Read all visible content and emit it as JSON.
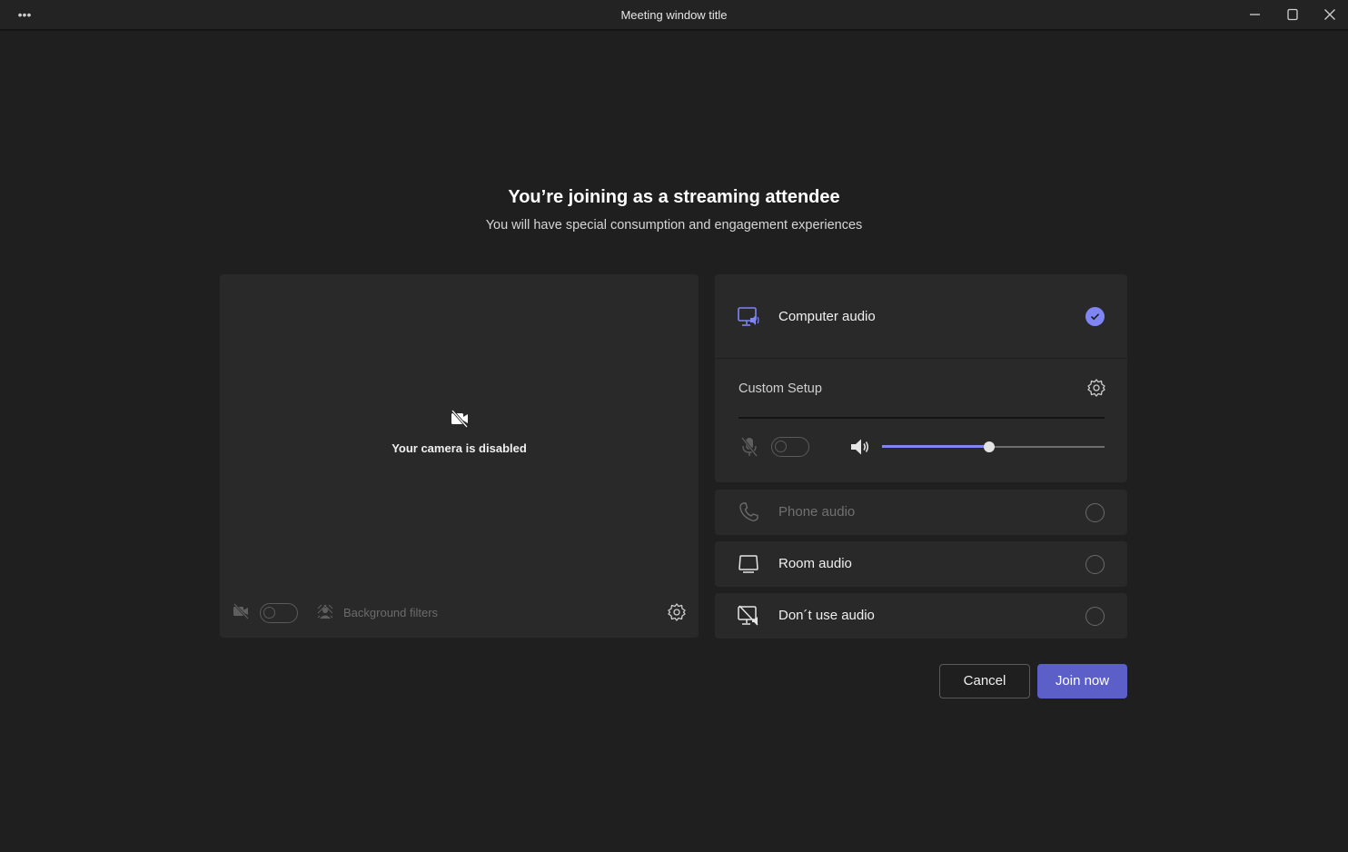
{
  "window": {
    "title": "Meeting window title",
    "more_label": "•••",
    "controls": [
      "minimize",
      "maximize",
      "close"
    ]
  },
  "header": {
    "title": "You’re joining as a streaming attendee",
    "subtitle": "You will have special consumption and engagement experiences"
  },
  "video": {
    "status_text": "Your camera is disabled",
    "camera_toggle_on": false,
    "background_filters_label": "Background filters"
  },
  "audio": {
    "accent_color": "#7f85f5",
    "options": [
      {
        "label": "Computer audio",
        "icon": "computer-audio-icon",
        "selected": true
      },
      {
        "label": "Phone audio",
        "icon": "phone-icon",
        "selected": false,
        "disabled": true
      },
      {
        "label": "Room audio",
        "icon": "room-audio-icon",
        "selected": false
      },
      {
        "label": "Don´t use audio",
        "icon": "no-audio-icon",
        "selected": false
      }
    ],
    "custom_setup_label": "Custom Setup",
    "mic_toggle_on": false,
    "speaker_volume_percent": 48
  },
  "actions": {
    "cancel_label": "Cancel",
    "join_label": "Join now",
    "join_color": "#5b5fc7"
  }
}
